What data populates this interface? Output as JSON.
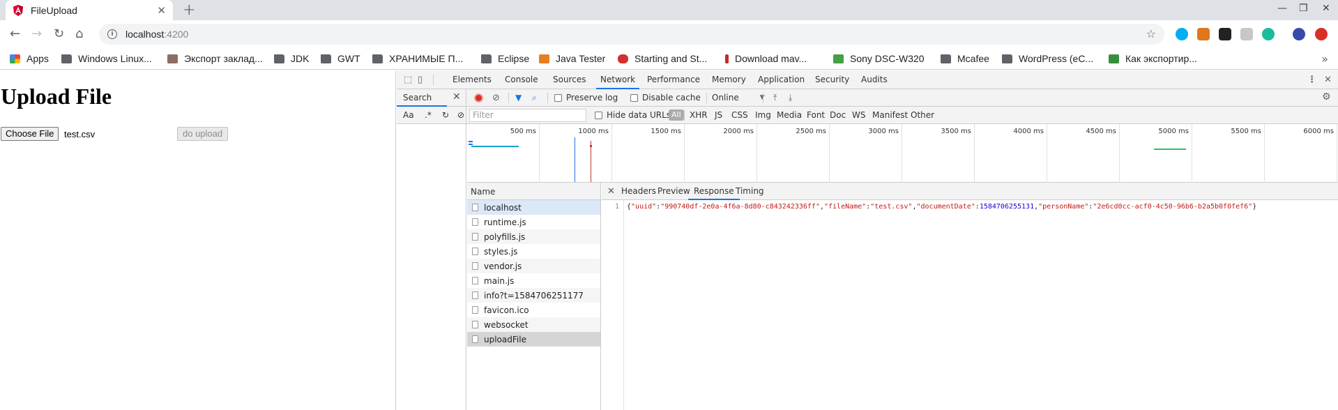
{
  "browser": {
    "tab_title": "FileUpload",
    "url_host": "localhost",
    "url_port": ":4200"
  },
  "bookmarks": [
    {
      "label": "Apps",
      "icon": "apps-grid-icon",
      "color": "#ea4335"
    },
    {
      "label": "Windows Linux...",
      "icon": "folder-icon",
      "color": "#5f6368"
    },
    {
      "label": "Экспорт заклад...",
      "icon": "bookmark-favicon",
      "color": "#8d6e63"
    },
    {
      "label": "JDK",
      "icon": "folder-icon",
      "color": "#5f6368"
    },
    {
      "label": "GWT",
      "icon": "folder-icon",
      "color": "#5f6368"
    },
    {
      "label": "ХРАНИМЫЕ П...",
      "icon": "folder-icon",
      "color": "#5f6368"
    },
    {
      "label": "Eclipse",
      "icon": "folder-icon",
      "color": "#5f6368"
    },
    {
      "label": "Java Tester",
      "icon": "java-icon",
      "color": "#e67e22"
    },
    {
      "label": "Starting and St...",
      "icon": "oracle-icon",
      "color": "#d32f2f"
    },
    {
      "label": "Download mav...",
      "icon": "maven-icon",
      "color": "#c62828"
    },
    {
      "label": "Sony DSC-W320",
      "icon": "sony-icon",
      "color": "#43a047"
    },
    {
      "label": "Mcafee",
      "icon": "folder-icon",
      "color": "#5f6368"
    },
    {
      "label": "WordPress (eC...",
      "icon": "folder-icon",
      "color": "#5f6368"
    },
    {
      "label": "Как экспортир...",
      "icon": "sheet-icon",
      "color": "#388e3c"
    }
  ],
  "page": {
    "heading": "Upload File",
    "choose_file_label": "Choose File",
    "file_name": "test.csv",
    "upload_label": "do upload"
  },
  "devtools": {
    "tabs": [
      "Elements",
      "Console",
      "Sources",
      "Network",
      "Performance",
      "Memory",
      "Application",
      "Security",
      "Audits"
    ],
    "active_tab": "Network",
    "search_label": "Search",
    "search_case": "Aa",
    "search_regex": ".*",
    "preserve_log": "Preserve log",
    "disable_cache": "Disable cache",
    "throttle": "Online",
    "filter_placeholder": "Filter",
    "hide_data_urls": "Hide data URLs",
    "type_filters": [
      "All",
      "XHR",
      "JS",
      "CSS",
      "Img",
      "Media",
      "Font",
      "Doc",
      "WS",
      "Manifest",
      "Other"
    ],
    "timeline_labels": [
      "500 ms",
      "1000 ms",
      "1500 ms",
      "2000 ms",
      "2500 ms",
      "3000 ms",
      "3500 ms",
      "4000 ms",
      "4500 ms",
      "5000 ms",
      "5500 ms",
      "6000 ms"
    ],
    "name_header": "Name",
    "requests": [
      "localhost",
      "runtime.js",
      "polyfills.js",
      "styles.js",
      "vendor.js",
      "main.js",
      "info?t=1584706251177",
      "favicon.ico",
      "websocket",
      "uploadFile"
    ],
    "detail_tabs": [
      "Headers",
      "Preview",
      "Response",
      "Timing"
    ],
    "active_detail_tab": "Response",
    "line_number": "1",
    "response": {
      "uuid_key": "\"uuid\"",
      "uuid_val": "\"990740df-2e0a-4f6a-8d80-c843242336ff\"",
      "filename_key": "\"fileName\"",
      "filename_val": "\"test.csv\"",
      "date_key": "\"documentDate\"",
      "date_val": "1584706255131",
      "person_key": "\"personName\"",
      "person_val": "\"2e6cd0cc-acf0-4c50-96b6-b2a5b0f0fef6\""
    }
  }
}
